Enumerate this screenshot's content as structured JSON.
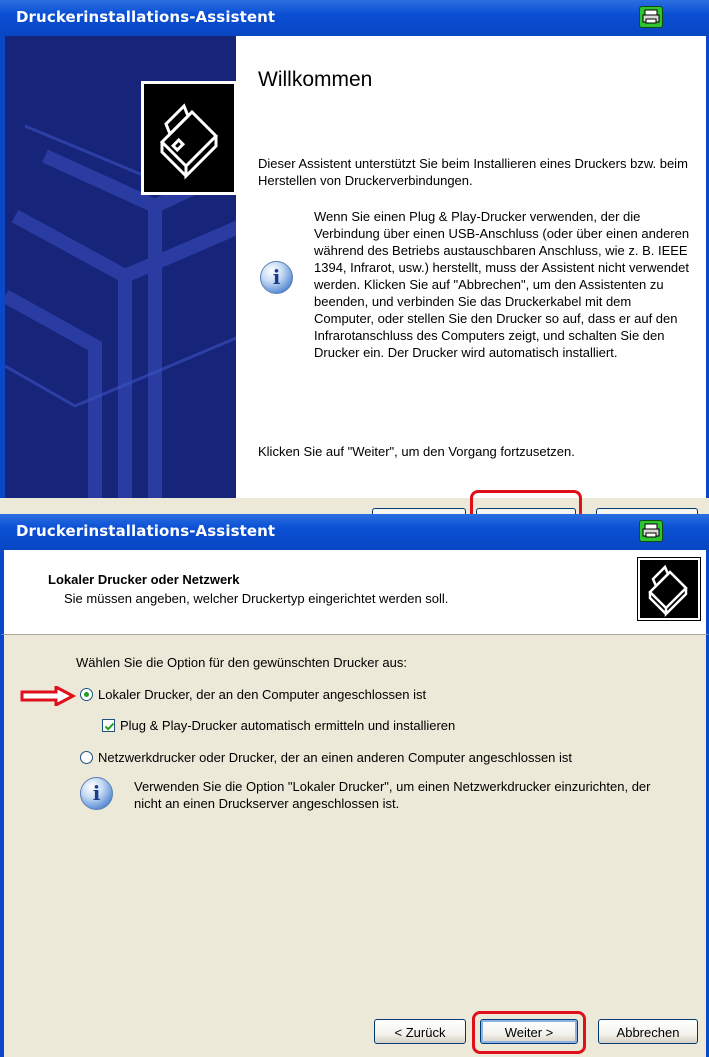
{
  "dialog1": {
    "title": "Druckerinstallations-Assistent",
    "heading": "Willkommen",
    "intro": "Dieser Assistent unterstützt Sie beim Installieren eines Druckers bzw. beim Herstellen von Druckerverbindungen.",
    "info_text": "Wenn Sie einen Plug & Play-Drucker verwenden, der die Verbindung über einen USB-Anschluss (oder über einen anderen während des Betriebs austauschbaren Anschluss, wie z. B. IEEE 1394, Infrarot, usw.) herstellt, muss der Assistent nicht verwendet werden. Klicken Sie auf \"Abbrechen\", um den Assistenten zu beenden, und verbinden Sie das Druckerkabel mit dem Computer, oder stellen Sie den Drucker so auf, dass er auf den Infrarotanschluss des Computers zeigt, und schalten Sie den Drucker ein. Der Drucker wird automatisch installiert.",
    "continue_text": "Klicken Sie auf \"Weiter\", um den Vorgang fortzusetzen."
  },
  "dialog2": {
    "title": "Druckerinstallations-Assistent",
    "header_title": "Lokaler Drucker oder Netzwerk",
    "header_subtitle": "Sie müssen angeben, welcher Druckertyp eingerichtet werden soll.",
    "prompt": "Wählen Sie die Option für den gewünschten Drucker aus:",
    "option_local": "Lokaler Drucker, der an den Computer angeschlossen ist",
    "option_pnp": "Plug & Play-Drucker automatisch ermitteln und installieren",
    "option_network": "Netzwerkdrucker oder Drucker, der an einen anderen Computer angeschlossen ist",
    "info_text": "Verwenden Sie die Option \"Lokaler Drucker\", um einen Netzwerkdrucker einzurichten, der nicht an einen Druckserver angeschlossen ist.",
    "buttons": {
      "back": "< Zurück",
      "next": "Weiter >",
      "cancel": "Abbrechen"
    },
    "state": {
      "selected_option": "local",
      "pnp_checked": true
    }
  },
  "colors": {
    "titlebar": "#0a4fd4",
    "dialog_bg": "#ece9d8",
    "highlight": "#e0101a",
    "sidebar": "#16247a"
  },
  "icons": [
    "printer-icon",
    "info-icon",
    "red-arrow-icon"
  ]
}
